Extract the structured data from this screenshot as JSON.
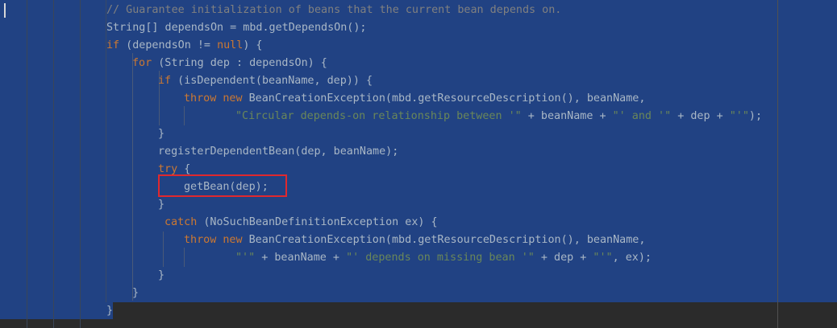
{
  "colors": {
    "editor_background": "#2b2b2b",
    "selection": "#214283",
    "keyword": "#cc7832",
    "string": "#6a8759",
    "comment": "#808080",
    "default_text": "#a9b7c6",
    "highlight_box": "#e0282e"
  },
  "code": {
    "line1": {
      "comment": "// Guarantee initialization of beans that the current bean depends on."
    },
    "line2": {
      "text": "String[] dependsOn = mbd.getDependsOn();"
    },
    "line3": {
      "kw_if": "if",
      "text_a": " (dependsOn != ",
      "kw_null": "null",
      "text_b": ") {"
    },
    "line4": {
      "kw_for": "for",
      "text": " (String dep : dependsOn) {"
    },
    "line5": {
      "kw_if": "if",
      "text": " (isDependent(beanName, dep)) {"
    },
    "line6": {
      "kw_throw": "throw",
      "kw_new": "new",
      "text": " BeanCreationException(mbd.getResourceDescription(), beanName,"
    },
    "line7": {
      "str_a": "\"Circular depends-on relationship between '\"",
      "text_a": " + beanName + ",
      "str_b": "\"' and '\"",
      "text_b": " + dep + ",
      "str_c": "\"'\"",
      "text_c": ");"
    },
    "line8": {
      "text": "}"
    },
    "line9": {
      "text": "registerDependentBean(dep, beanName);"
    },
    "line10": {
      "kw_try": "try",
      "text": " {"
    },
    "line11": {
      "text": "getBean(dep);"
    },
    "line12": {
      "text": "}"
    },
    "line13": {
      "kw_catch": "catch",
      "text": " (NoSuchBeanDefinitionException ex) {"
    },
    "line14": {
      "kw_throw": "throw",
      "kw_new": "new",
      "text": " BeanCreationException(mbd.getResourceDescription(), beanName,"
    },
    "line15": {
      "str_a": "\"'\"",
      "text_a": " + beanName + ",
      "str_b": "\"' depends on missing bean '\"",
      "text_b": " + dep + ",
      "str_c": "\"'\"",
      "text_c": ", ex);"
    },
    "line16": {
      "text": "}"
    },
    "line17": {
      "text": "}"
    },
    "line18": {
      "text": "}"
    }
  }
}
